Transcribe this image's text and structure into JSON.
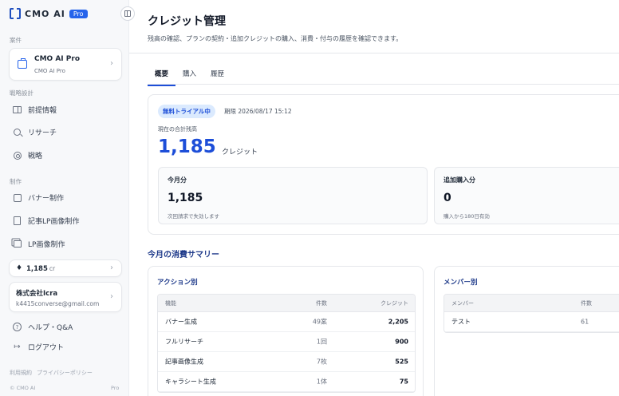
{
  "app": {
    "logo_text": "CMO AI",
    "badge": "Pro"
  },
  "sidebar": {
    "case_section": "案件",
    "case": {
      "title": "CMO AI Pro",
      "subtitle": "CMO AI Pro"
    },
    "strategy_section": "戦略設計",
    "strategy_items": [
      {
        "label": "前提情報",
        "icon": "book-icon"
      },
      {
        "label": "リサーチ",
        "icon": "search-icon"
      },
      {
        "label": "戦略",
        "icon": "target-icon"
      }
    ],
    "production_section": "制作",
    "production_items": [
      {
        "label": "バナー制作",
        "icon": "image-icon"
      },
      {
        "label": "記事LP画像制作",
        "icon": "file-image-icon"
      },
      {
        "label": "LP画像制作",
        "icon": "layers-icon"
      }
    ],
    "credits": {
      "value": "1,185",
      "unit": "cr"
    },
    "account": {
      "company": "株式会社Icra",
      "email": "k4415converse@gmail.com"
    },
    "help_label": "ヘルプ・Q&A",
    "logout_label": "ログアウト",
    "footer": {
      "terms": "利用規約",
      "privacy": "プライバシーポリシー",
      "copyright": "© CMO AI",
      "plan": "Pro"
    }
  },
  "main": {
    "title": "クレジット管理",
    "description": "残高の確認、プランの契約・追加クレジットの購入、消費・付与の履歴を確認できます。",
    "tabs": [
      {
        "label": "概要"
      },
      {
        "label": "購入"
      },
      {
        "label": "履歴"
      }
    ],
    "balance": {
      "trial_badge": "無料トライアル中",
      "expiry": "期限 2026/08/17 15:12",
      "total_label": "現在の合計残高",
      "total_value": "1,185",
      "total_unit": "クレジット",
      "monthly": {
        "title": "今月分",
        "value": "1,185",
        "note": "次回請求で失効します"
      },
      "additional": {
        "title": "追加購入分",
        "value": "0",
        "note": "購入から180日有効"
      }
    },
    "summary": {
      "title": "今月の消費サマリー",
      "by_action": {
        "title": "アクション別",
        "headers": {
          "name": "機能",
          "count": "件数",
          "credit": "クレジット"
        },
        "rows": [
          {
            "name": "バナー生成",
            "count": "49案",
            "credit": "2,205"
          },
          {
            "name": "フルリサーチ",
            "count": "1回",
            "credit": "900"
          },
          {
            "name": "記事画像生成",
            "count": "7枚",
            "credit": "525"
          },
          {
            "name": "キャラシート生成",
            "count": "1体",
            "credit": "75"
          }
        ]
      },
      "by_member": {
        "title": "メンバー別",
        "headers": {
          "name": "メンバー",
          "count": "件数"
        },
        "rows": [
          {
            "name": "テスト",
            "count": "61"
          }
        ]
      }
    }
  }
}
